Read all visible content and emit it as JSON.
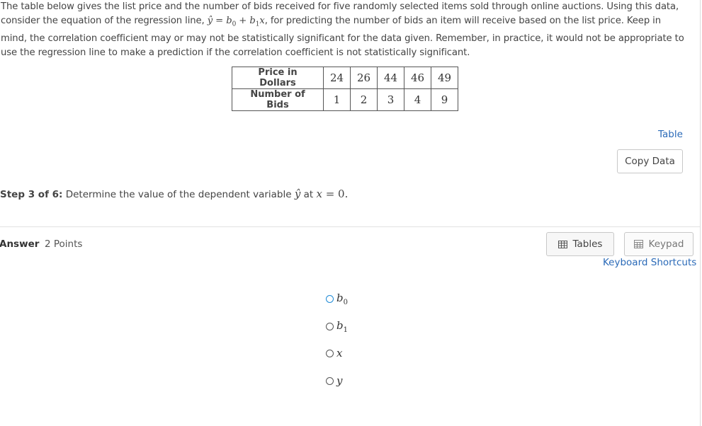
{
  "intro": {
    "p1": "The table below gives the list price and the number of bids received for five randomly selected items sold through online auctions. Using this data, consider the equation of the regression line, ",
    "eq_yhat": "ŷ",
    "eq_eq": " = ",
    "eq_b0": "b",
    "eq_plus": " + ",
    "eq_b1": "b",
    "eq_x": "x",
    "p2": ", for predicting the number of bids an item will receive based on the list price. Keep in mind, the correlation coefficient may or may not be statistically significant for the data given. Remember, in practice, it would not be appropriate to use the regression line to make a prediction if the correlation coefficient is not statistically significant."
  },
  "data_table": {
    "row1_header": "Price in Dollars",
    "row1_values": [
      "24",
      "26",
      "44",
      "46",
      "49"
    ],
    "row2_header": "Number of Bids",
    "row2_values": [
      "1",
      "2",
      "3",
      "4",
      "9"
    ]
  },
  "table_link": "Table",
  "copy_button": "Copy Data",
  "step": {
    "label": "Step 3 of 6:",
    "text_before": " Determine the value of the dependent variable ",
    "yhat": "ŷ",
    "text_at": " at ",
    "x": "x",
    "eq": " = 0."
  },
  "answer": {
    "label": "Answer",
    "points": "2 Points"
  },
  "tools": {
    "tables": "Tables",
    "keypad": "Keypad",
    "shortcuts": "Keyboard Shortcuts"
  },
  "options": [
    {
      "var": "b",
      "sub": "0"
    },
    {
      "var": "b",
      "sub": "1"
    },
    {
      "var": "x",
      "sub": ""
    },
    {
      "var": "y",
      "sub": ""
    }
  ],
  "colors": {
    "link": "#2a6ab8",
    "focus_ring": "#1e8ad6",
    "text": "#444444"
  }
}
